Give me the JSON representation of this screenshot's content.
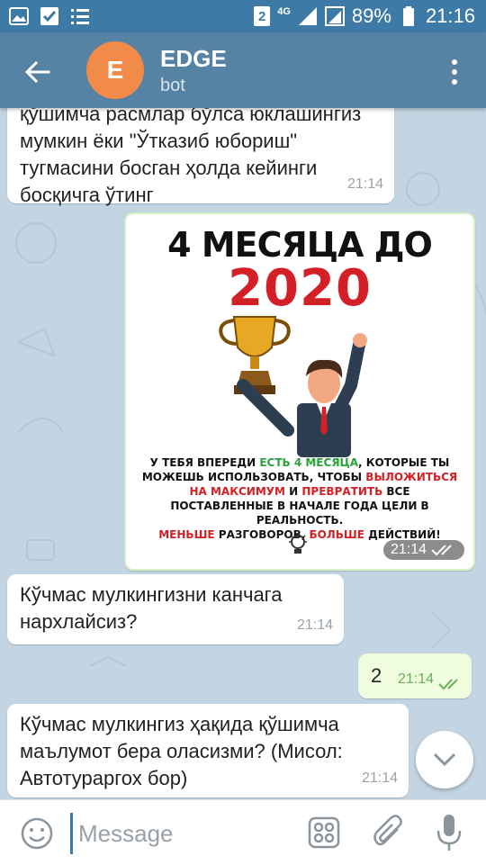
{
  "status_bar": {
    "sim_number": "2",
    "network": "4G",
    "battery": "89%",
    "time": "21:16"
  },
  "header": {
    "avatar_letter": "E",
    "title": "EDGE",
    "subtitle": "bot"
  },
  "messages": [
    {
      "direction": "in",
      "text": "қўшимча расмлар бўлса юклашингиз мумкин ёки \"Ўтказиб юбориш\" тугмасини босган ҳолда кейинги босқичга ўтинг",
      "time": "21:14"
    },
    {
      "direction": "out",
      "type": "image",
      "image": {
        "title_line1": "4 МЕСЯЦА ДО",
        "title_line2": "2020",
        "caption": {
          "p1": "У ТЕБЯ ВПЕРЕДИ ",
          "p2": "ЕСТЬ 4 МЕСЯЦА",
          "p3": ", КОТОРЫЕ ТЫ МОЖЕШЬ ИСПОЛЬЗОВАТЬ, ЧТОБЫ ",
          "p4": "ВЫЛОЖИТЬСЯ НА МАКСИМУМ",
          "p5": " И ",
          "p6": "ПРЕВРАТИТЬ",
          "p7": " ВСЕ ПОСТАВЛЕННЫЕ В НАЧАЛЕ ГОДА ЦЕЛИ В РЕАЛЬНОСТЬ.",
          "p8": "МЕНЬШЕ",
          "p9": " РАЗГОВОРОВ, ",
          "p10": "БОЛЬШЕ",
          "p11": " ДЕЙСТВИЙ!"
        }
      },
      "time": "21:14",
      "status": "read"
    },
    {
      "direction": "in",
      "text": "Кўчмас мулкингизни канчага нархлайсиз?",
      "time": "21:14"
    },
    {
      "direction": "out",
      "text": "2",
      "time": "21:14",
      "status": "read"
    },
    {
      "direction": "in",
      "text": "Кўчмас мулкингиз ҳақида қўшимча маълумот бера оласизми? (Мисол: Автотураргох бор)",
      "time": "21:14"
    }
  ],
  "input": {
    "placeholder": "Message"
  },
  "colors": {
    "status_bar": "#3d7aa6",
    "app_bar": "#5682a3",
    "avatar": "#f28b4a",
    "chat_background": "#c3d5e2",
    "outgoing_bubble": "#effdde",
    "incoming_bubble": "#ffffff",
    "accent_red": "#d32027",
    "accent_green": "#29a33a"
  },
  "icons": {
    "status": [
      "image-icon",
      "checkbox-icon",
      "list-icon",
      "sim-icon",
      "signal-icon",
      "battery-icon"
    ],
    "header": [
      "back-arrow-icon",
      "more-vert-icon"
    ],
    "input": [
      "emoji-icon",
      "bot-commands-icon",
      "attach-icon",
      "mic-icon"
    ],
    "chat": [
      "chevron-down-icon",
      "double-check-icon"
    ]
  }
}
